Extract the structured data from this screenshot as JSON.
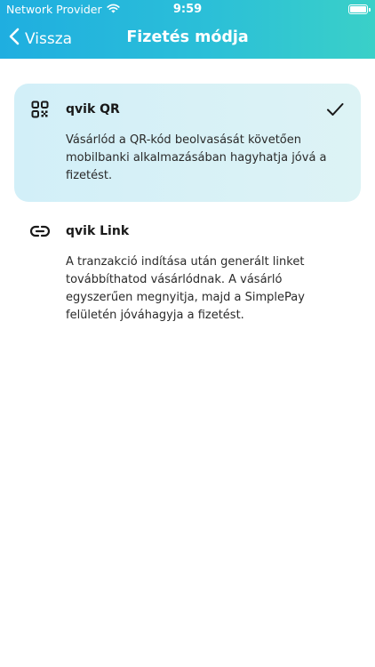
{
  "status": {
    "carrier": "Network Provider",
    "time": "9:59"
  },
  "nav": {
    "back_label": "Vissza",
    "title": "Fizetés módja"
  },
  "options": [
    {
      "icon": "qr-code-icon",
      "title": "qvik QR",
      "description": "Vásárlód a QR-kód beolvasását követően mobilbanki alkalmazásában hagyhatja jóvá a fizetést.",
      "selected": true
    },
    {
      "icon": "link-icon",
      "title": "qvik Link",
      "description": "A tranzakció indítása után generált linket továbbíthatod vásárlódnak. A vásárló egyszerűen megnyitja, majd a SimplePay felületén jóváhagyja a fizetést.",
      "selected": false
    }
  ],
  "colors": {
    "header_start": "#1faee0",
    "header_end": "#3ad0c8",
    "selected_bg": "#d2eff8"
  }
}
